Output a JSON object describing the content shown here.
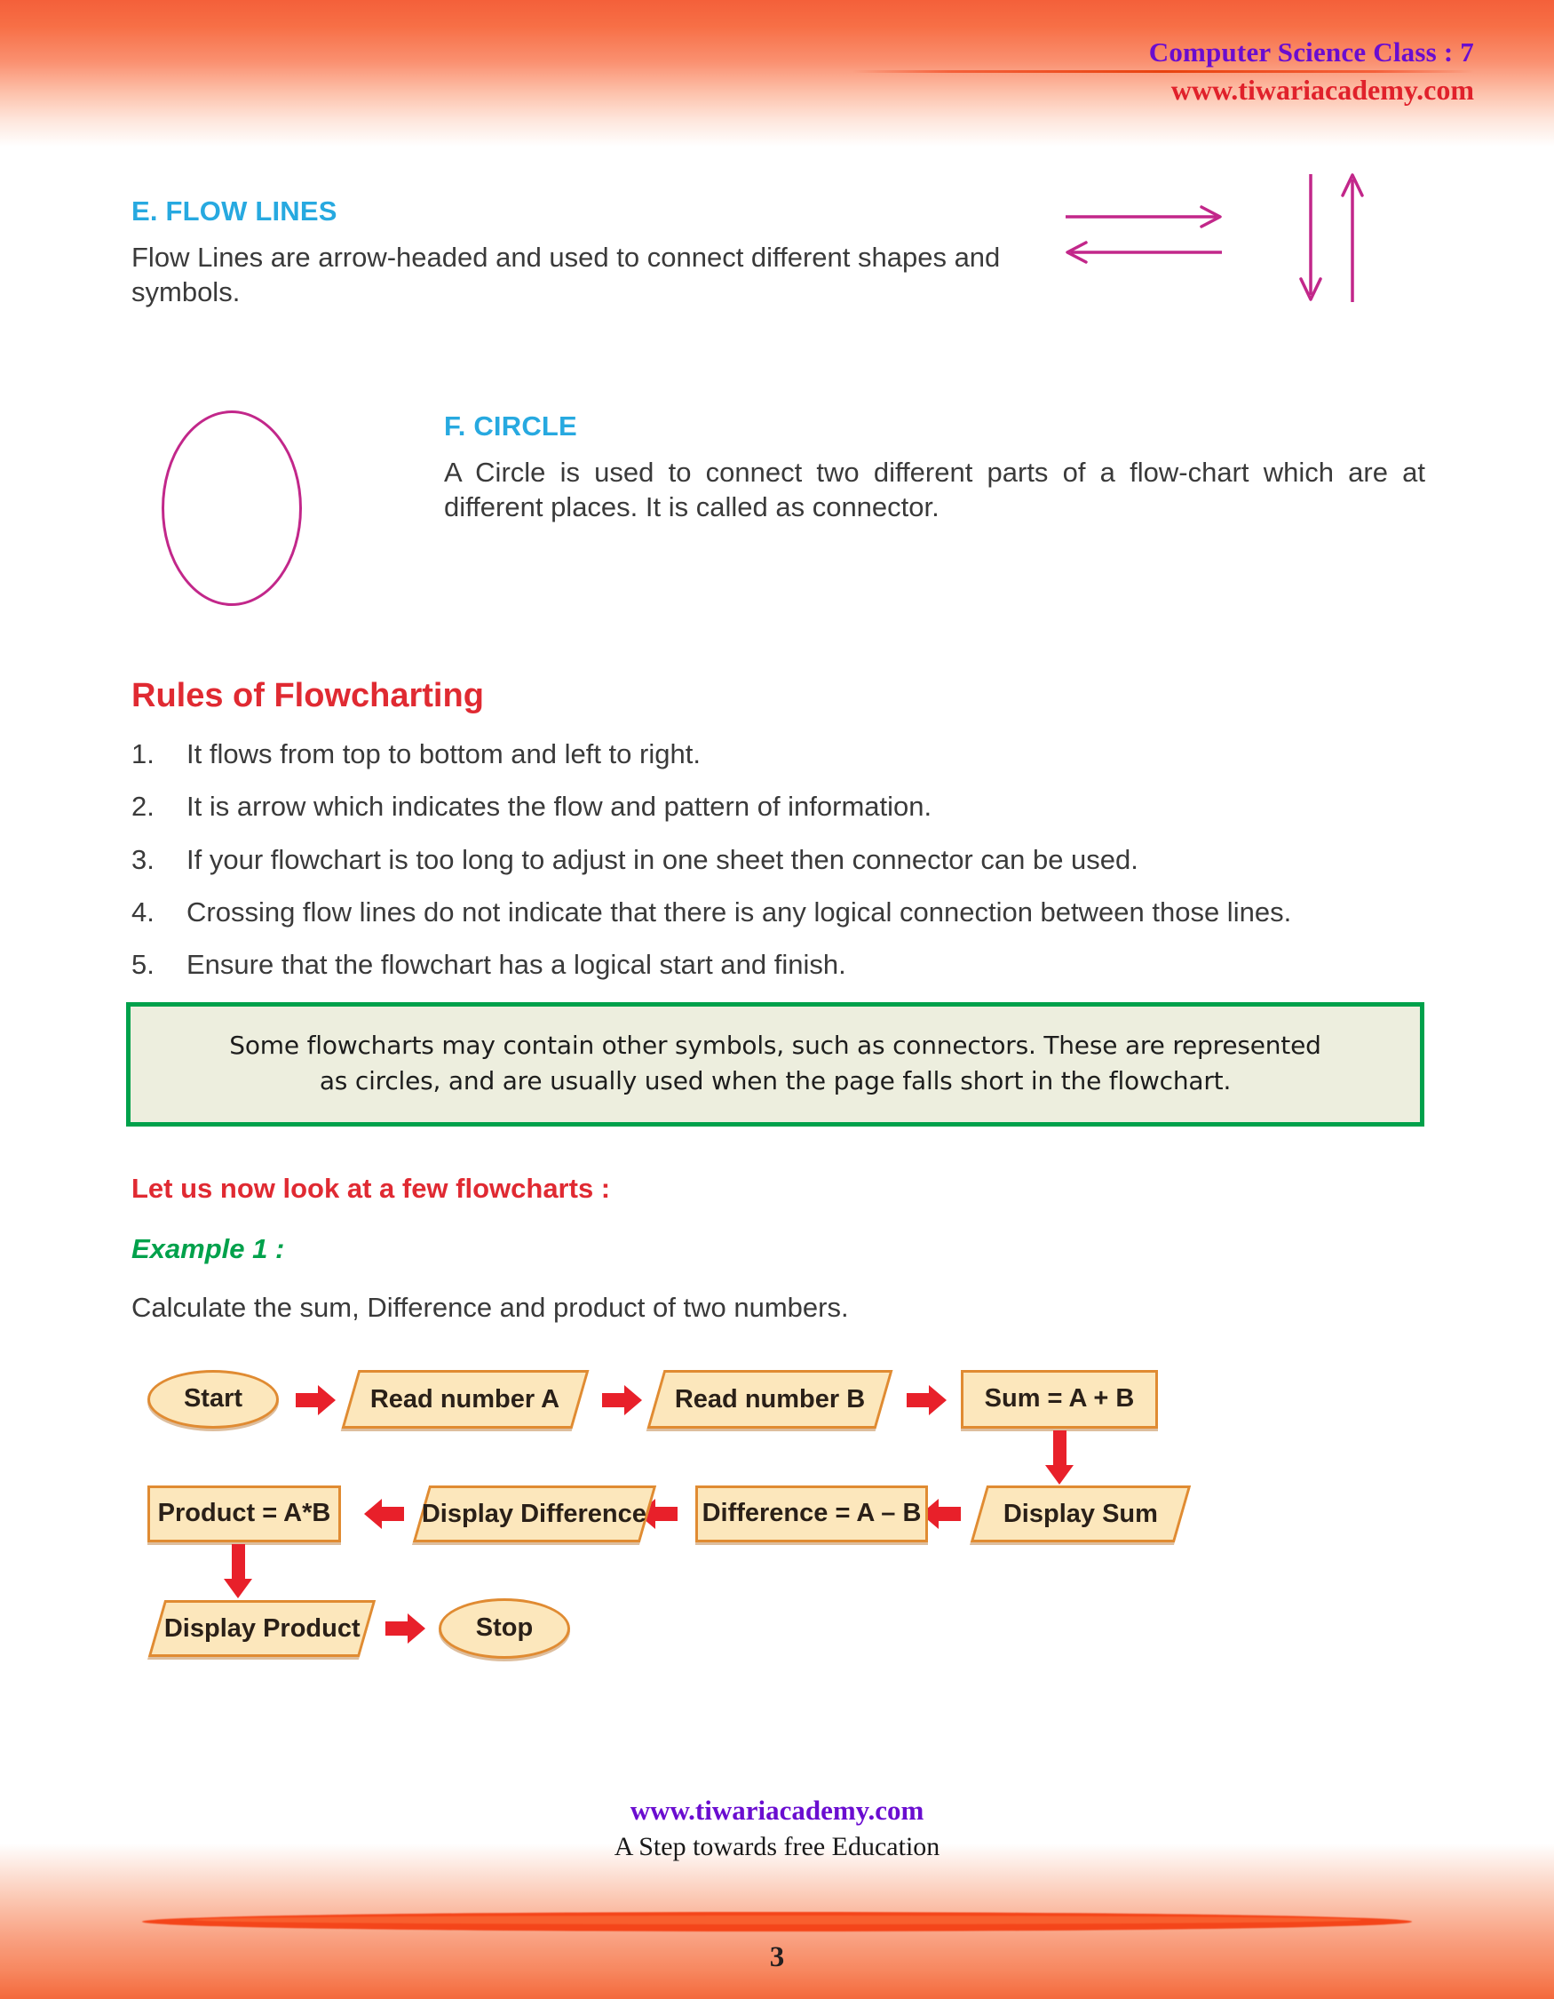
{
  "header": {
    "class_title": "Computer Science Class : 7",
    "website": "www.tiwariacademy.com"
  },
  "sections": {
    "flow_lines": {
      "heading": "E. FLOW LINES",
      "body": "Flow Lines are arrow-headed and used to connect different shapes and symbols.",
      "arrow_color": "#c2278a",
      "arrows": [
        "arrow-right",
        "arrow-left",
        "arrow-down",
        "arrow-up"
      ]
    },
    "circle": {
      "heading": "F. CIRCLE",
      "body": "A Circle is used to connect two different parts of a flow-chart which are at different places. It is called as connector.",
      "shape_color": "#c2278a"
    }
  },
  "rules": {
    "heading": "Rules of Flowcharting",
    "heading_color": "#e02a32",
    "items": [
      {
        "num": "1.",
        "text": "It flows from top to bottom and left to right."
      },
      {
        "num": "2.",
        "text": "It is arrow which indicates the flow and pattern of information."
      },
      {
        "num": "3.",
        "text": "If your flowchart is too long to adjust in one sheet then connector can be used."
      },
      {
        "num": "4.",
        "text": "Crossing flow lines do not indicate that there is any logical connection between those lines."
      },
      {
        "num": "5.",
        "text": "Ensure that the flowchart has a logical start and finish."
      }
    ]
  },
  "callout": {
    "line1": "Some flowcharts may contain other symbols, such as connectors. These are represented",
    "line2": "as circles, and are usually used when the page falls short in the flowchart.",
    "border_color": "#00a14b",
    "background_color": "#edeede"
  },
  "example_intro": {
    "lets_look": "Let us now look at a few flowcharts :",
    "example_label": "Example 1 :",
    "example_desc": "Calculate the sum, Difference and product of two numbers."
  },
  "flowchart": {
    "fill_color": "#fce7bc",
    "border_color": "#e08b32",
    "arrow_color": "#e8202a",
    "nodes": [
      {
        "id": "start",
        "label": "Start",
        "shape": "ellipse"
      },
      {
        "id": "read_a",
        "label": "Read number A",
        "shape": "parallelogram"
      },
      {
        "id": "read_b",
        "label": "Read number B",
        "shape": "parallelogram"
      },
      {
        "id": "sum",
        "label": "Sum = A + B",
        "shape": "rectangle"
      },
      {
        "id": "display_sum",
        "label": "Display Sum",
        "shape": "parallelogram"
      },
      {
        "id": "difference",
        "label": "Difference = A – B",
        "shape": "rectangle"
      },
      {
        "id": "display_difference",
        "label": "Display Difference",
        "shape": "parallelogram"
      },
      {
        "id": "product",
        "label": "Product = A*B",
        "shape": "rectangle"
      },
      {
        "id": "display_product",
        "label": "Display Product",
        "shape": "parallelogram"
      },
      {
        "id": "stop",
        "label": "Stop",
        "shape": "ellipse"
      }
    ],
    "edges": [
      {
        "from": "start",
        "to": "read_a",
        "direction": "right"
      },
      {
        "from": "read_a",
        "to": "read_b",
        "direction": "right"
      },
      {
        "from": "read_b",
        "to": "sum",
        "direction": "right"
      },
      {
        "from": "sum",
        "to": "display_sum",
        "direction": "down"
      },
      {
        "from": "display_sum",
        "to": "difference",
        "direction": "left"
      },
      {
        "from": "difference",
        "to": "display_difference",
        "direction": "left"
      },
      {
        "from": "display_difference",
        "to": "product",
        "direction": "left"
      },
      {
        "from": "product",
        "to": "display_product",
        "direction": "down"
      },
      {
        "from": "display_product",
        "to": "stop",
        "direction": "right"
      }
    ]
  },
  "footer": {
    "website": "www.tiwariacademy.com",
    "tagline": "A Step towards free Education",
    "page_number": "3"
  }
}
